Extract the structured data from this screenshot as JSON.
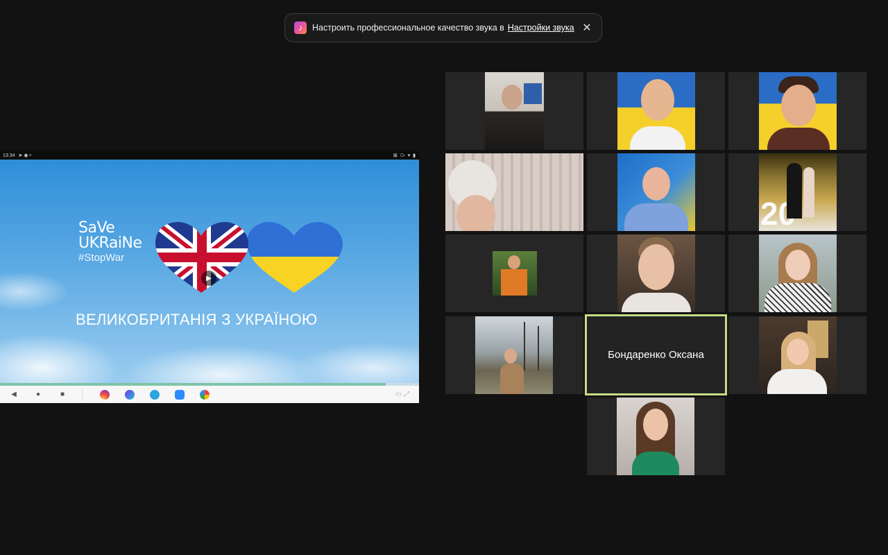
{
  "banner": {
    "icon": "music-note-icon",
    "text": "Настроить профессиональное качество звука в",
    "link": "Настройки звука",
    "close": "✕"
  },
  "shared_screen": {
    "status_time": "13:34",
    "status_icons": "⊠ ⧂ ▾ ▮",
    "logo_line1": "SaVe",
    "logo_line2": "UKRaiNe",
    "logo_line3": "#StopWar",
    "headline": "ВЕЛИКОБРИТАНІЯ З УКРАЇНОЮ",
    "video_progress": 0.92,
    "apps": [
      "instagram-icon",
      "canva-icon",
      "telegram-icon",
      "zoom-icon",
      "google-icon"
    ]
  },
  "participants": {
    "active_speaker": "Бондаренко Оксана"
  },
  "colors": {
    "active_border": "#c6dd86",
    "background": "#121212",
    "tile": "#262626"
  }
}
